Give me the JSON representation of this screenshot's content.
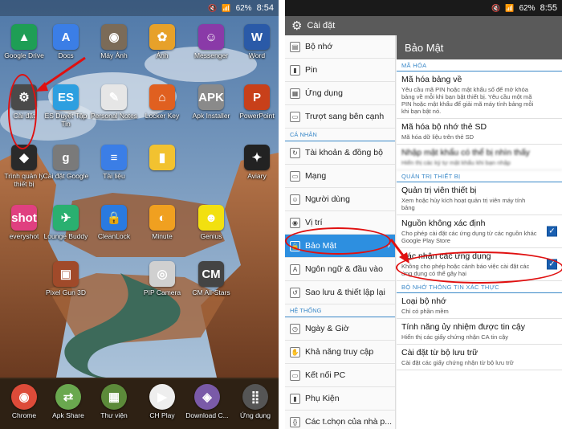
{
  "left_screen": {
    "status": {
      "battery": "62%",
      "time": "8:54"
    },
    "apps": [
      {
        "label": "Google Drive",
        "icon": "drive-icon",
        "color": "#1e9e55",
        "glyph": "▲"
      },
      {
        "label": "Docs",
        "icon": "docs-icon",
        "color": "#3b7ee6",
        "glyph": "A"
      },
      {
        "label": "Máy Ảnh",
        "icon": "camera-icon",
        "color": "#7b6b58",
        "glyph": "◉"
      },
      {
        "label": "Ảnh",
        "icon": "photos-icon",
        "color": "#e7a12a",
        "glyph": "✿"
      },
      {
        "label": "Messenger",
        "icon": "messenger-icon",
        "color": "#8a3aa8",
        "glyph": "☺"
      },
      {
        "label": "Word",
        "icon": "word-icon",
        "color": "#2a5aa8",
        "glyph": "W"
      },
      {
        "label": "Cài đặt",
        "icon": "gear-icon",
        "color": "#4a4a4a",
        "glyph": "⚙"
      },
      {
        "label": "ES Duyệt Tập Tin",
        "icon": "folder-icon",
        "color": "#2d9fe0",
        "glyph": "ES"
      },
      {
        "label": "Personal Notes",
        "icon": "notes-icon",
        "color": "#e6e6e6",
        "glyph": "✎"
      },
      {
        "label": "Locker Key",
        "icon": "home-lock-icon",
        "color": "#e06020",
        "glyph": "⌂"
      },
      {
        "label": "Apk Installer",
        "icon": "apk-icon",
        "color": "#8a8a8a",
        "glyph": "APK"
      },
      {
        "label": "PowerPoint",
        "icon": "powerpoint-icon",
        "color": "#c8401a",
        "glyph": "P"
      },
      {
        "label": "Trình quản lý thiết bị",
        "icon": "shield-icon",
        "color": "#2a2a2a",
        "glyph": "◆"
      },
      {
        "label": "Cài đặt Google",
        "icon": "google-settings-icon",
        "color": "#7a7a7a",
        "glyph": "g"
      },
      {
        "label": "Tài liệu",
        "icon": "document-icon",
        "color": "#3b7ee6",
        "glyph": "≡"
      },
      {
        "label": "",
        "icon": "file-icon",
        "color": "#f2c230",
        "glyph": "▮"
      },
      {
        "label": "Aviary",
        "icon": "aviary-icon",
        "color": "#222222",
        "glyph": "✦"
      },
      {
        "label": "everyshot",
        "icon": "everyshot-icon",
        "color": "#e04080",
        "glyph": "shot"
      },
      {
        "label": "Lounge Buddy",
        "icon": "loungebuddy-icon",
        "color": "#2ab070",
        "glyph": "✈"
      },
      {
        "label": "CleanLock",
        "icon": "lock-icon",
        "color": "#2a7ae0",
        "glyph": "🔒"
      },
      {
        "label": "Minute",
        "icon": "minute-icon",
        "color": "#f0a020",
        "glyph": "◐"
      },
      {
        "label": "Genius",
        "icon": "genius-icon",
        "color": "#f2e010",
        "glyph": "☻"
      },
      {
        "label": "Pixel Gun 3D",
        "icon": "pixelgun-icon",
        "color": "#a04a2a",
        "glyph": "▣"
      },
      {
        "label": "PIP Camera",
        "icon": "pip-camera-icon",
        "color": "#d0d0d0",
        "glyph": "◎"
      },
      {
        "label": "CM All-Stars",
        "icon": "cm-allstars-icon",
        "color": "#444444",
        "glyph": "CM"
      }
    ],
    "dock": [
      {
        "label": "Chrome",
        "icon": "chrome-icon",
        "color": "#dd4b39",
        "glyph": "◉"
      },
      {
        "label": "Apk Share",
        "icon": "apk-share-icon",
        "color": "#6aa84f",
        "glyph": "⇄"
      },
      {
        "label": "Thư viện",
        "icon": "gallery-icon",
        "color": "#5c8a3a",
        "glyph": "▦"
      },
      {
        "label": "CH Play",
        "icon": "play-store-icon",
        "color": "#eeeeee",
        "glyph": "▶"
      },
      {
        "label": "Download C...",
        "icon": "download-icon",
        "color": "#7a5aa8",
        "glyph": "◈"
      },
      {
        "label": "Ứng dụng",
        "icon": "apps-grid-icon",
        "color": "#555555",
        "glyph": "⣿"
      }
    ]
  },
  "right_screen": {
    "status": {
      "battery": "62%",
      "time": "8:55"
    },
    "action_bar_title": "Cài đặt",
    "nav": [
      {
        "type": "item",
        "label": "Bộ nhớ",
        "glyph": "▤"
      },
      {
        "type": "item",
        "label": "Pin",
        "glyph": "▮"
      },
      {
        "type": "item",
        "label": "Ứng dụng",
        "glyph": "▦"
      },
      {
        "type": "item",
        "label": "Trượt sang bên cạnh",
        "glyph": "▭"
      },
      {
        "type": "section",
        "label": "CÁ NHÂN"
      },
      {
        "type": "item",
        "label": "Tài khoản & đồng bộ",
        "glyph": "↻"
      },
      {
        "type": "item",
        "label": "Mạng",
        "glyph": "▭"
      },
      {
        "type": "item",
        "label": "Người dùng",
        "glyph": "☺"
      },
      {
        "type": "item",
        "label": "Vị trí",
        "glyph": "◉"
      },
      {
        "type": "item",
        "label": "Bảo Mật",
        "glyph": "🔒",
        "active": true
      },
      {
        "type": "item",
        "label": "Ngôn ngữ & đầu vào",
        "glyph": "A"
      },
      {
        "type": "item",
        "label": "Sao lưu & thiết lập lại",
        "glyph": "↺"
      },
      {
        "type": "section",
        "label": "HỆ THỐNG"
      },
      {
        "type": "item",
        "label": "Ngày & Giờ",
        "glyph": "◷"
      },
      {
        "type": "item",
        "label": "Khả năng truy cập",
        "glyph": "✋"
      },
      {
        "type": "item",
        "label": "Kết nối PC",
        "glyph": "▭"
      },
      {
        "type": "item",
        "label": "Phụ Kiện",
        "glyph": "▮"
      },
      {
        "type": "item",
        "label": "Các t.chọn của nhà p...",
        "glyph": "{}"
      }
    ],
    "detail_title": "Bảo Mật",
    "detail": [
      {
        "type": "section",
        "label": "MÃ HÓA"
      },
      {
        "type": "item",
        "title": "Mã hóa bảng về",
        "sub": "Yêu cầu mã PIN hoặc mật khẩu số để mở khóa bảng về mỗi khi bạn bật thiết bị. Yêu cầu một mã PIN hoặc mật khẩu để giải mã máy tính bảng mỗi khi bạn bật nó."
      },
      {
        "type": "item",
        "title": "Mã hóa bộ nhớ thẻ SD",
        "sub": "Mã hóa dữ liệu trên thẻ SD"
      },
      {
        "type": "item",
        "title": "Nhập mật khẩu có thể bị nhìn thấy",
        "sub": "Hiển thị các ký tự mật khẩu khi bạn nhập",
        "blurred": true
      },
      {
        "type": "section",
        "label": "QUẢN TRỊ THIẾT BỊ"
      },
      {
        "type": "item",
        "title": "Quản trị viên thiết bị",
        "sub": "Xem hoặc hủy kích hoạt quản trị viên máy tính bảng"
      },
      {
        "type": "item",
        "title": "Nguồn không xác định",
        "sub": "Cho phép cài đặt các ứng dụng từ các nguồn khác Google Play Store",
        "checked": true
      },
      {
        "type": "item",
        "title": "Xác nhận các ứng dụng",
        "sub": "Không cho phép hoặc cảnh báo việc cài đặt các ứng dụng có thể gây hại",
        "checked": true
      },
      {
        "type": "section",
        "label": "BỘ NHỚ THÔNG TIN XÁC THỰC"
      },
      {
        "type": "item",
        "title": "Loại bộ nhớ",
        "sub": "Chỉ có phần mềm"
      },
      {
        "type": "item",
        "title": "Tính năng ủy nhiệm được tin cậy",
        "sub": "Hiển thị các giấy chứng nhận CA tin cậy"
      },
      {
        "type": "item",
        "title": "Cài đặt từ bộ lưu trữ",
        "sub": "Cài đặt các giấy chứng nhận từ bộ lưu trữ"
      }
    ]
  }
}
